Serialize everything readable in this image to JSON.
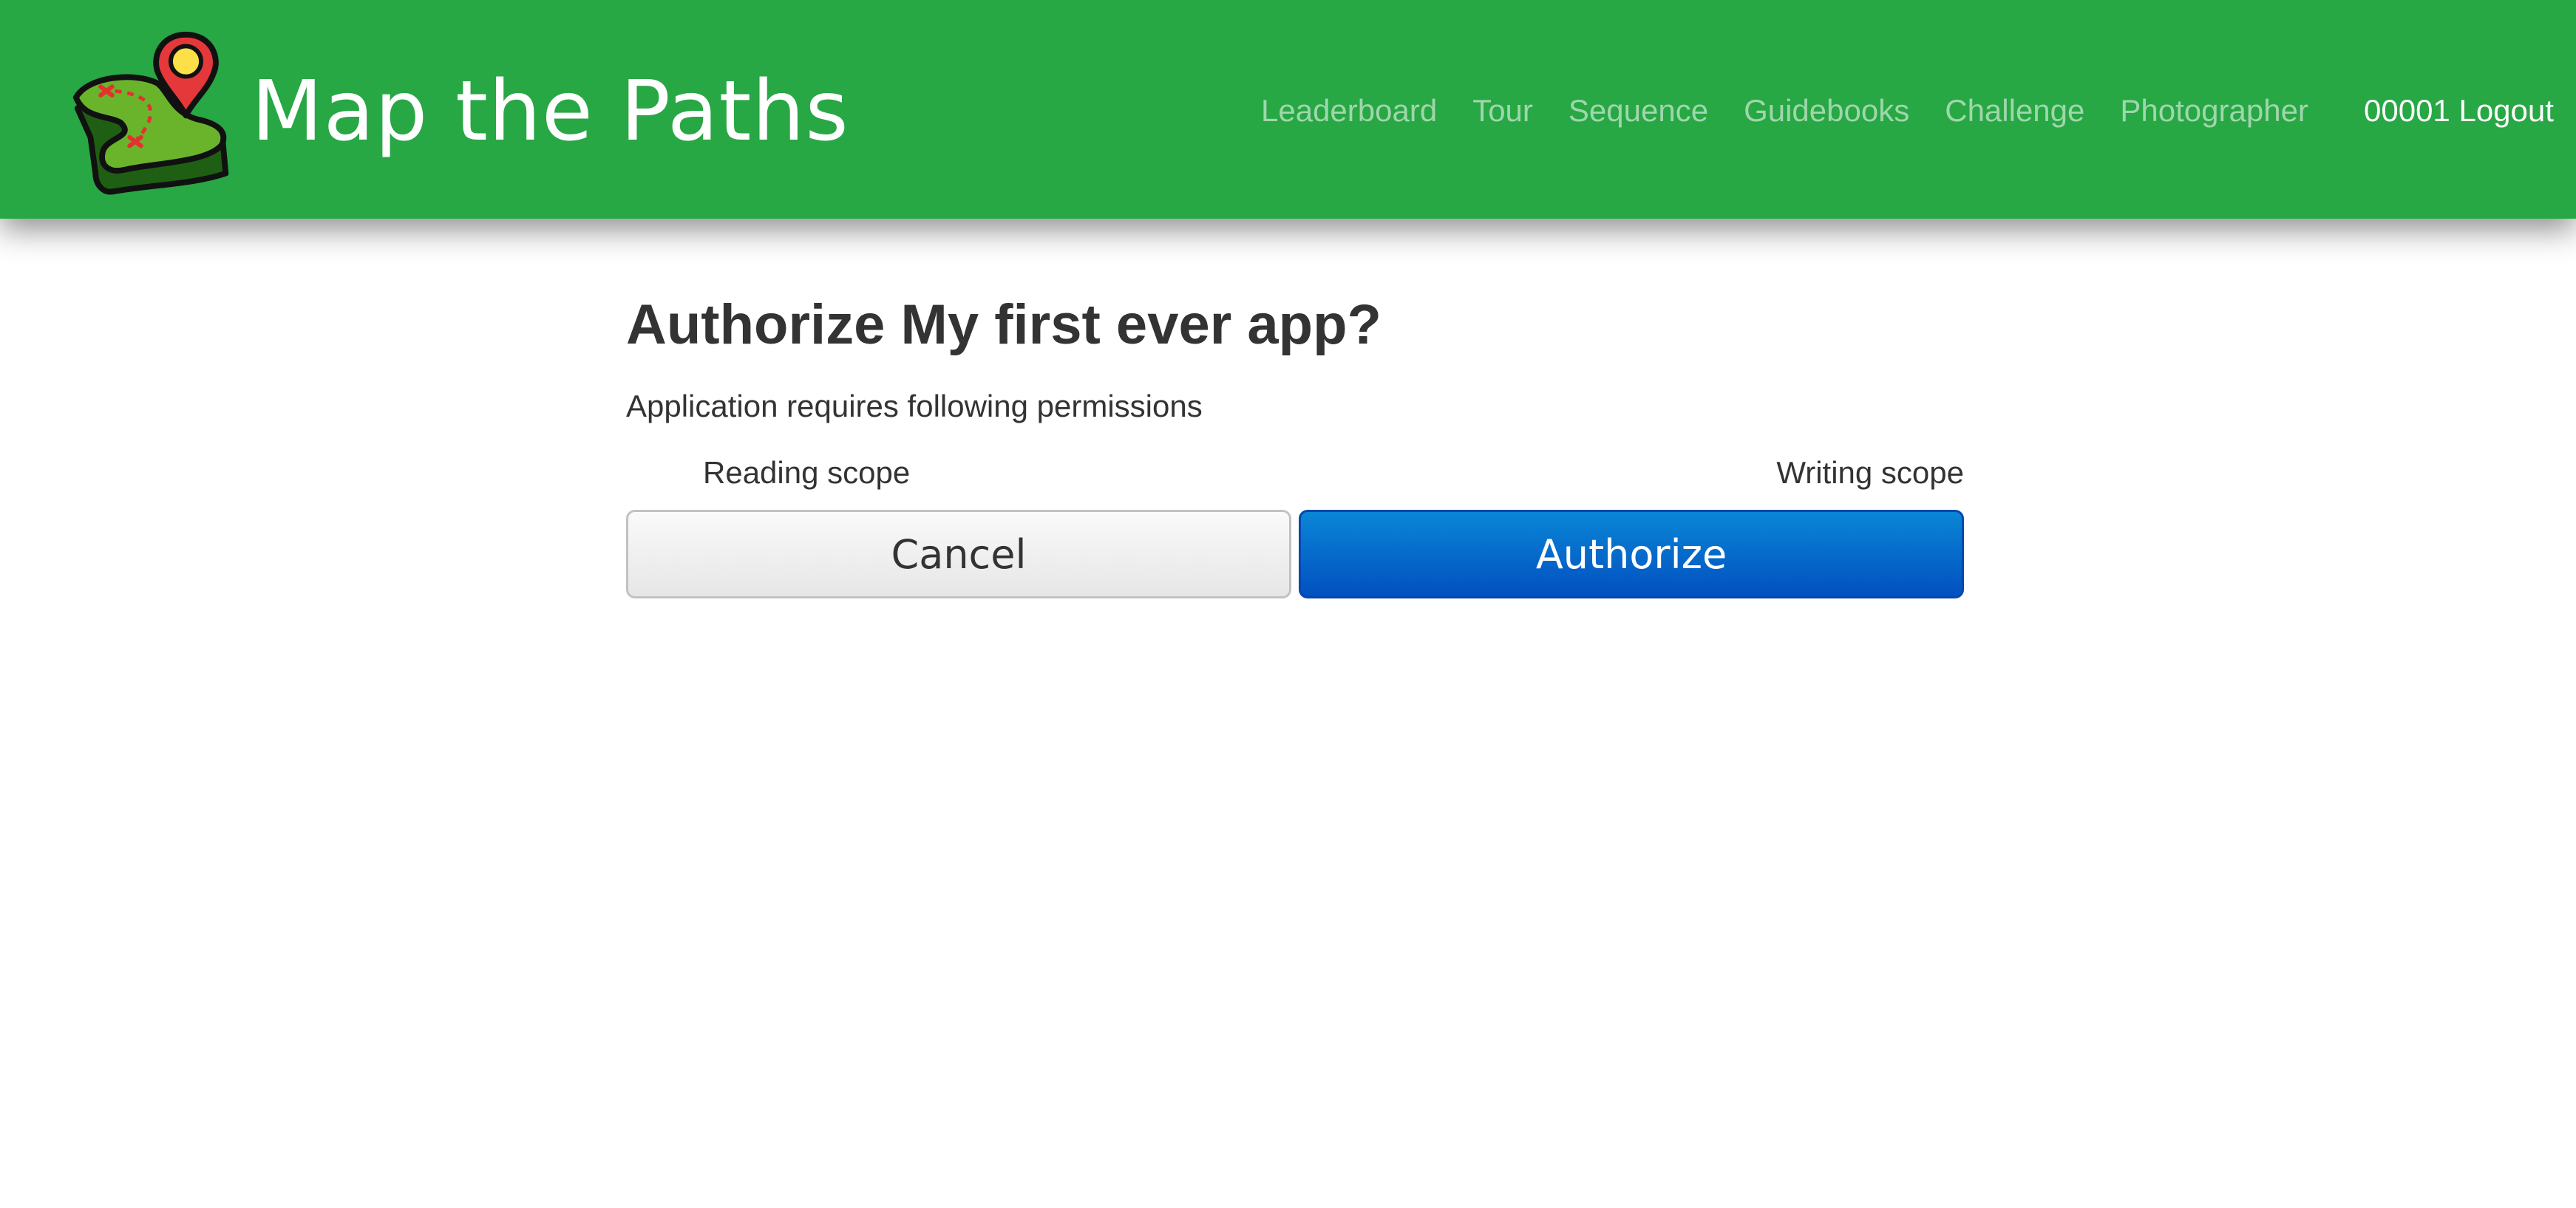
{
  "brand": {
    "name": "Map the Paths"
  },
  "nav": {
    "links": [
      "Leaderboard",
      "Tour",
      "Sequence",
      "Guidebooks",
      "Challenge",
      "Photographer"
    ],
    "user_logout": "00001 Logout"
  },
  "page": {
    "title": "Authorize My first ever app?",
    "permissions_intro": "Application requires following permissions",
    "scopes": [
      "Reading scope",
      "Writing scope"
    ],
    "cancel_label": "Cancel",
    "authorize_label": "Authorize"
  },
  "colors": {
    "navbar": "#28a745",
    "authorize_button": "#0052c4",
    "cancel_button": "#eeeeee",
    "text": "#333333"
  },
  "icons": {
    "logo": "map-pin-path-logo-icon"
  }
}
